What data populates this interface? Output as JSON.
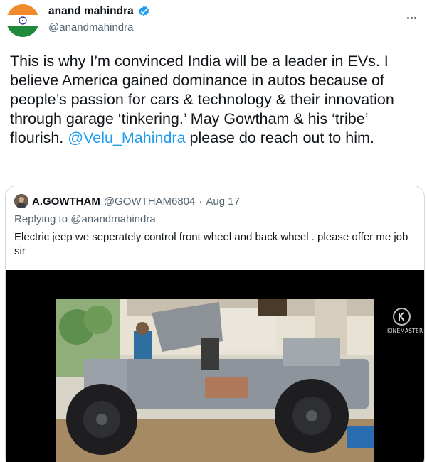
{
  "author": {
    "name": "anand mahindra",
    "handle": "@anandmahindra",
    "avatar_icon": "india-flag-avatar",
    "verified_color": "#1d9bf0"
  },
  "tweet": {
    "text_before": "This is why I’m convinced India will be a leader in EVs. I believe America gained dominance in autos because of people’s passion for cars & technology & their innovation through garage ‘tinkering.’ May Gowtham & his ‘tribe’ flourish. ",
    "mention": "@Velu_Mahindra",
    "text_after": " please do reach out to him."
  },
  "quoted_tweet": {
    "name": "A.GOWTHAM",
    "handle": "@GOWTHAM6804",
    "separator": "·",
    "date": "Aug 17",
    "replying_to": "Replying to @anandmahindra",
    "text": "Electric jeep we seperately control front wheel and back wheel . please offer me job sir",
    "media": {
      "watermark": "KINEMASTER"
    }
  },
  "colors": {
    "link": "#1d9bf0",
    "secondary_text": "#536471",
    "border": "#cfd9de"
  }
}
